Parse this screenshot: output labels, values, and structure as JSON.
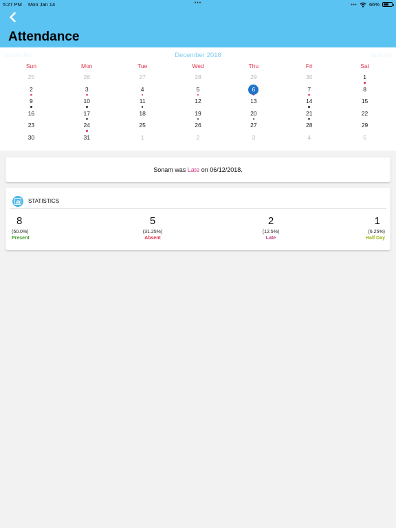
{
  "status_bar": {
    "time": "5:27 PM",
    "date": "Mon Jan 14",
    "battery": "66%",
    "battery_level": 0.66
  },
  "header": {
    "title": "Attendance",
    "back_icon": "chevron-left-icon"
  },
  "calendar": {
    "month_label": "December 2018",
    "prev_label": "November",
    "next_label": "January",
    "weekdays": [
      "Sun",
      "Mon",
      "Tue",
      "Wed",
      "Thu",
      "Fri",
      "Sat"
    ],
    "weeks": [
      [
        {
          "d": "25",
          "o": true
        },
        {
          "d": "26",
          "o": true
        },
        {
          "d": "27",
          "o": true
        },
        {
          "d": "28",
          "o": true
        },
        {
          "d": "29",
          "o": true
        },
        {
          "d": "30",
          "o": true
        },
        {
          "d": "1",
          "dot": "#e0344e"
        }
      ],
      [
        {
          "d": "2",
          "dot": "#e0344e"
        },
        {
          "d": "3",
          "dot": "#e0344e"
        },
        {
          "d": "4",
          "dot": "#e0344e"
        },
        {
          "d": "5",
          "dot": "#e0344e"
        },
        {
          "d": "6",
          "today": true,
          "dot": "#e0344e"
        },
        {
          "d": "7",
          "dot": "#e0344e"
        },
        {
          "d": "8"
        }
      ],
      [
        {
          "d": "9",
          "dot": "#333333"
        },
        {
          "d": "10",
          "dot": "#333333"
        },
        {
          "d": "11",
          "dot": "#333333"
        },
        {
          "d": "12"
        },
        {
          "d": "13"
        },
        {
          "d": "14",
          "dot": "#333333"
        },
        {
          "d": "15"
        }
      ],
      [
        {
          "d": "16"
        },
        {
          "d": "17",
          "dot": "#333333"
        },
        {
          "d": "18"
        },
        {
          "d": "19",
          "dot": "#333333"
        },
        {
          "d": "20",
          "dot": "#333333"
        },
        {
          "d": "21",
          "dot": "#333333"
        },
        {
          "d": "22"
        }
      ],
      [
        {
          "d": "23"
        },
        {
          "d": "24",
          "dot": "#e0344e"
        },
        {
          "d": "25"
        },
        {
          "d": "26"
        },
        {
          "d": "27"
        },
        {
          "d": "28"
        },
        {
          "d": "29"
        }
      ],
      [
        {
          "d": "30"
        },
        {
          "d": "31"
        },
        {
          "d": "1",
          "o": true
        },
        {
          "d": "2",
          "o": true
        },
        {
          "d": "3",
          "o": true
        },
        {
          "d": "4",
          "o": true
        },
        {
          "d": "5",
          "o": true
        }
      ]
    ]
  },
  "message": {
    "prefix": "Sonam was ",
    "status": "Late",
    "suffix": " on 06/12/2018.",
    "status_color": "#d4418e"
  },
  "statistics": {
    "title": "STATISTICS",
    "icon": "bar-chart-icon",
    "items": [
      {
        "count": "8",
        "percent": "(50.0%)",
        "label": "Present",
        "color": "#3f9a2b"
      },
      {
        "count": "5",
        "percent": "(31.25%)",
        "label": "Absent",
        "color": "#e0344e"
      },
      {
        "count": "2",
        "percent": "(12.5%)",
        "label": "Late",
        "color": "#c23a7e"
      },
      {
        "count": "1",
        "percent": "(6.25%)",
        "label": "Half Day",
        "color": "#9ab51e"
      }
    ]
  }
}
